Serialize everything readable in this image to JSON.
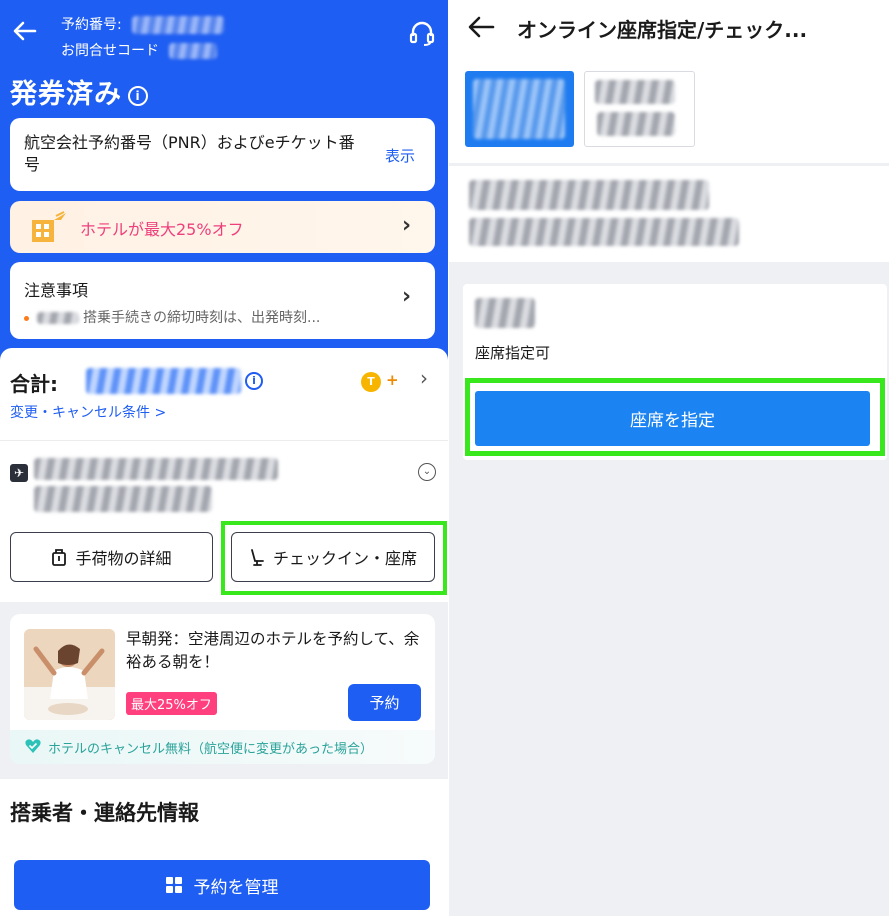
{
  "left": {
    "header": {
      "booking_no_label": "予約番号:",
      "inquiry_code_label": "お問合せコード",
      "status_title": "発券済み",
      "info_glyph": "i"
    },
    "pnr_card": {
      "text": "航空会社予約番号（PNR）およびeチケット番号",
      "action": "表示"
    },
    "hotel_banner": {
      "text": "ホテルが最大25%オフ"
    },
    "notice": {
      "title": "注意事項",
      "text": "搭乗手続きの締切時刻は、出発時刻..."
    },
    "total": {
      "label": "合計:",
      "coin_glyph": "T",
      "coin_plus": "+",
      "change_link": "変更・キャンセル条件 >"
    },
    "flight": {
      "plane_glyph": "✈",
      "expand_glyph": "⌄"
    },
    "buttons": {
      "baggage": "手荷物の詳細",
      "checkin": "チェックイン・座席"
    },
    "promo": {
      "title": "早朝発：空港周辺のホテルを予約して、余裕ある朝を！",
      "badge": "最大25%オフ",
      "book": "予約",
      "footer": "ホテルのキャンセル無料（航空便に変更があった場合）"
    },
    "passenger_section": {
      "title": "搭乗者・連絡先情報",
      "manage_button": "予約を管理"
    }
  },
  "right": {
    "title": "オンライン座席指定/チェック...",
    "seat_status": "座席指定可",
    "seat_button": "座席を指定"
  },
  "colors": {
    "brand_blue": "#1f5ef2",
    "seat_button_blue": "#1b84f2",
    "highlight_green": "#39e81c",
    "promo_pink": "#ff3f7e",
    "hotel_text_pink": "#ee3f7c"
  },
  "icons": [
    "back-arrow-icon",
    "headset-icon",
    "info-icon",
    "hotel-icon",
    "chevron-right-icon",
    "coin-icon",
    "plane-icon",
    "expand-icon",
    "luggage-icon",
    "seat-icon",
    "heart-check-icon",
    "grid-icon"
  ]
}
